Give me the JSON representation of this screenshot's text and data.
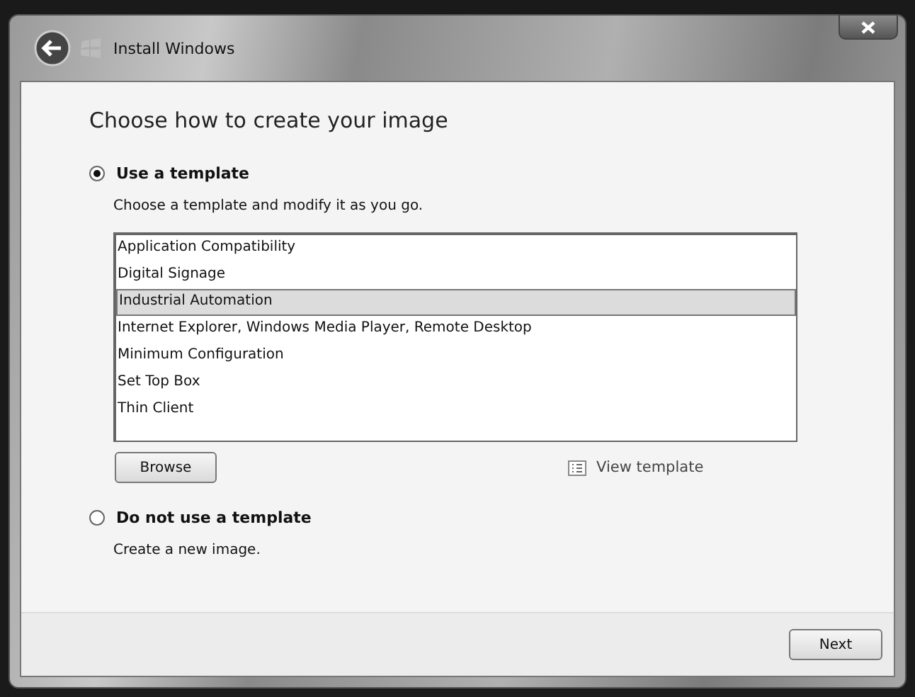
{
  "window": {
    "title": "Install Windows"
  },
  "heading": "Choose how to create your image",
  "options": [
    {
      "label": "Use a template",
      "selected": true,
      "description": "Choose a template and modify it as you go."
    },
    {
      "label": "Do not use a template",
      "selected": false,
      "description": "Create a new image."
    }
  ],
  "template_list": {
    "items": [
      {
        "label": "Application Compatibility",
        "selected": false
      },
      {
        "label": "Digital Signage",
        "selected": false
      },
      {
        "label": "Industrial Automation",
        "selected": true
      },
      {
        "label": "Internet Explorer, Windows Media Player, Remote Desktop",
        "selected": false
      },
      {
        "label": "Minimum Configuration",
        "selected": false
      },
      {
        "label": "Set Top Box",
        "selected": false
      },
      {
        "label": "Thin Client",
        "selected": false
      }
    ]
  },
  "browse_button": "Browse",
  "view_template_link": "View template",
  "next_button": "Next"
}
